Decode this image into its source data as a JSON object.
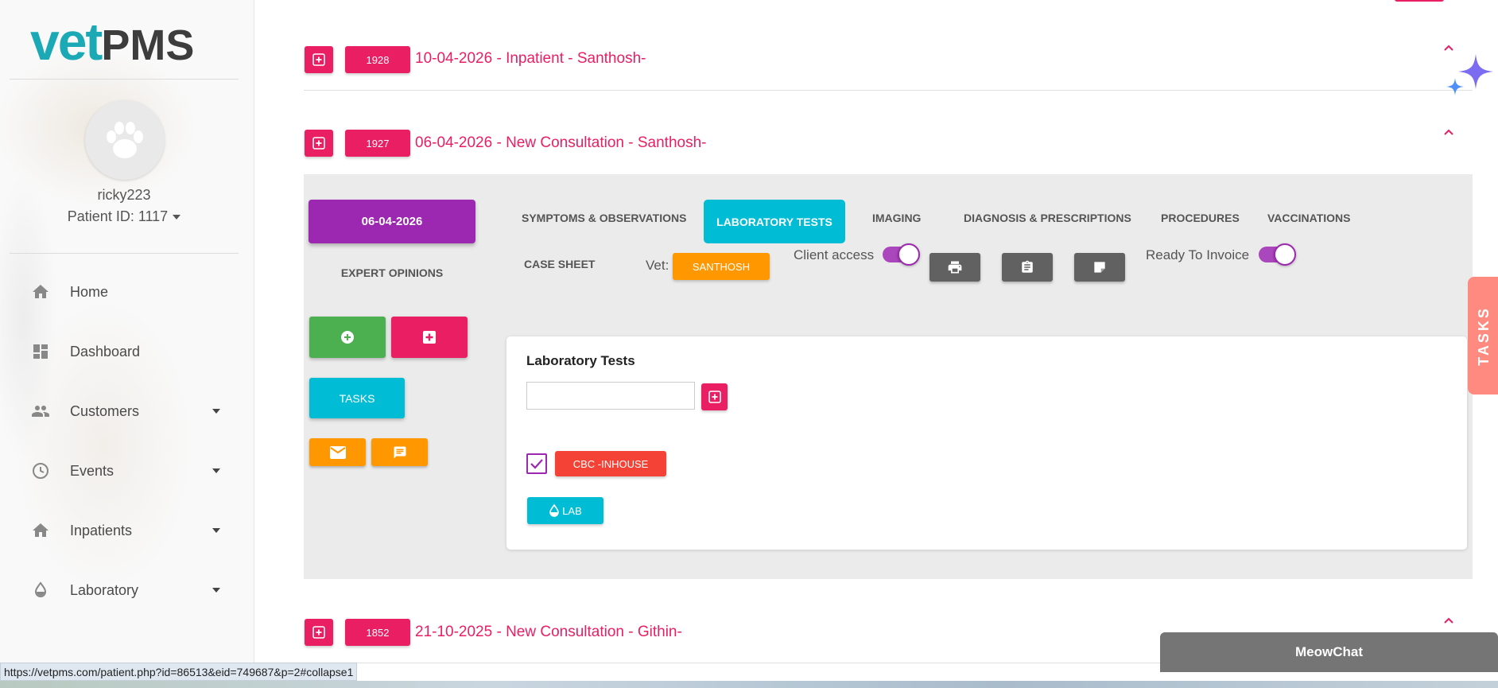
{
  "app": {
    "logo_vet": "vet",
    "logo_pms": "PMS"
  },
  "profile": {
    "username": "ricky223",
    "patient_id": "Patient ID: 1117"
  },
  "sidebar": {
    "items": [
      {
        "label": "Home",
        "icon": "home-icon",
        "has_caret": false
      },
      {
        "label": "Dashboard",
        "icon": "dashboard-icon",
        "has_caret": false
      },
      {
        "label": "Customers",
        "icon": "people-icon",
        "has_caret": true
      },
      {
        "label": "Events",
        "icon": "clock-icon",
        "has_caret": true
      },
      {
        "label": "Inpatients",
        "icon": "home-icon",
        "has_caret": true
      },
      {
        "label": "Laboratory",
        "icon": "drop-icon",
        "has_caret": true
      }
    ]
  },
  "records": [
    {
      "id": "1928",
      "title": "10-04-2026 - Inpatient - Santhosh-"
    },
    {
      "id": "1927",
      "title": "06-04-2026 - New Consultation - Santhosh-"
    },
    {
      "id": "1852",
      "title": "21-10-2025 - New Consultation - Githin-"
    }
  ],
  "visit": {
    "date": "06-04-2026",
    "expert_opinions": "EXPERT OPINIONS",
    "tabs": {
      "symptoms": "SYMPTOMS & OBSERVATIONS",
      "lab": "LABORATORY TESTS",
      "imaging": "IMAGING",
      "diagnosis": "DIAGNOSIS & PRESCRIPTIONS",
      "procedures": "PROCEDURES",
      "vaccinations": "VACCINATIONS",
      "case_sheet": "CASE SHEET"
    },
    "vet_label": "Vet:",
    "vet_name": "SANTHOSH",
    "client_access_label": "Client access",
    "client_access_on": true,
    "ready_to_invoice_label": "Ready To Invoice",
    "ready_to_invoice_on": true,
    "tasks_button": "TASKS"
  },
  "lab_tests": {
    "title": "Laboratory Tests",
    "input_value": "",
    "items": [
      {
        "label": "CBC -INHOUSE",
        "checked": true
      }
    ],
    "lab_button": "LAB"
  },
  "side_tab": "TASKS",
  "chat": {
    "label": "MeowChat"
  },
  "status_url": "https://vetpms.com/patient.php?id=86513&eid=749687&p=2#collapse1",
  "colors": {
    "accent": "#e91e63",
    "purple": "#9c27b0",
    "cyan": "#00bcd4",
    "orange": "#ff9800",
    "green": "#4caf50",
    "red": "#f44336",
    "logo_teal": "#1ba9b5"
  }
}
